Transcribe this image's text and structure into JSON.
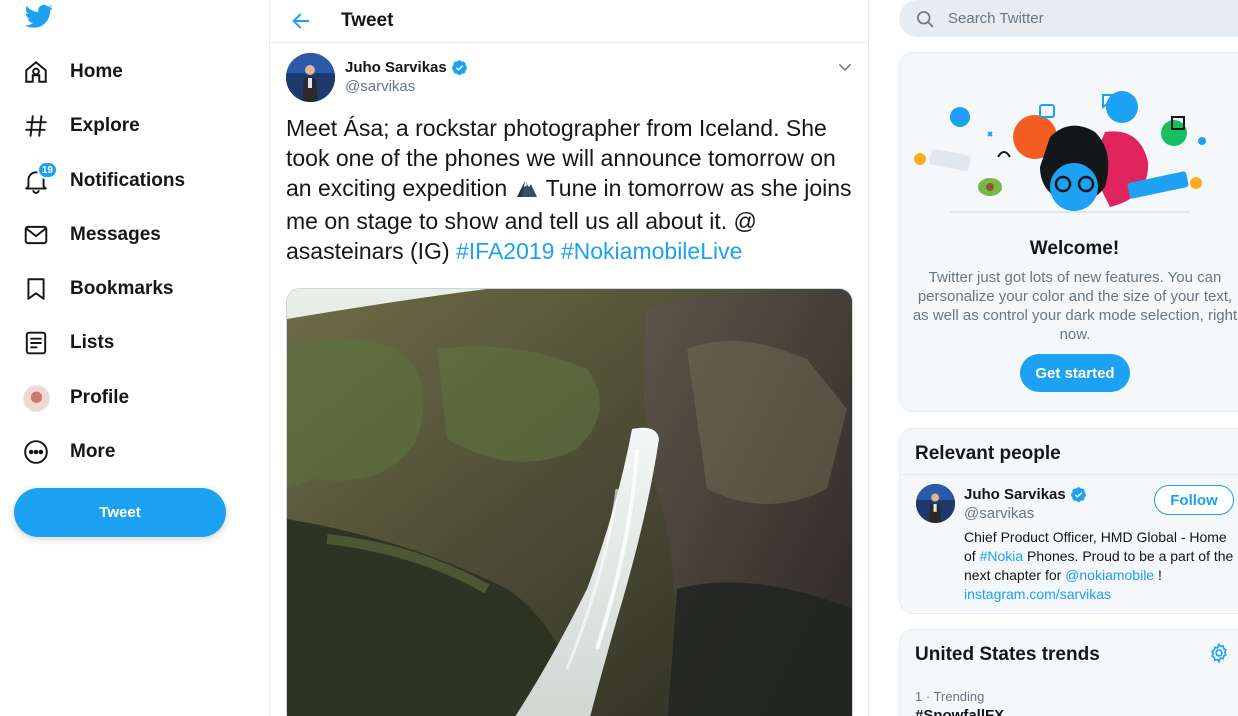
{
  "nav": {
    "logo_icon": "twitter-bird-icon",
    "items": [
      {
        "label": "Home",
        "icon": "home-icon"
      },
      {
        "label": "Explore",
        "icon": "hashtag-icon"
      },
      {
        "label": "Notifications",
        "icon": "bell-icon",
        "badge": "19"
      },
      {
        "label": "Messages",
        "icon": "envelope-icon"
      },
      {
        "label": "Bookmarks",
        "icon": "bookmark-icon"
      },
      {
        "label": "Lists",
        "icon": "list-icon"
      },
      {
        "label": "Profile",
        "icon": "avatar"
      },
      {
        "label": "More",
        "icon": "more-icon"
      }
    ],
    "tweet_button": "Tweet"
  },
  "header": {
    "title": "Tweet"
  },
  "tweet": {
    "author_name": "Juho Sarvikas",
    "author_handle": "@sarvikas",
    "text_1": "Meet Ása; a rockstar photographer from Iceland. She took one of the phones we will announce tomorrow on an exciting expedition ",
    "text_2": " Tune in tomorrow as she joins me on stage to show and tell us all about it. @ asasteinars (IG) ",
    "hashtag_1": "#IFA2019",
    "hashtag_2": "#NokiamobileLive"
  },
  "search": {
    "placeholder": "Search Twitter"
  },
  "welcome": {
    "title": "Welcome!",
    "body": "Twitter just got lots of new features. You can personalize your color and the size of your text, as well as control your dark mode selection, right now.",
    "button": "Get started"
  },
  "relevant": {
    "title": "Relevant people",
    "name": "Juho Sarvikas",
    "handle": "@sarvikas",
    "follow": "Follow",
    "bio_1": "Chief Product Officer, HMD Global - Home of ",
    "bio_link_1": "#Nokia",
    "bio_2": " Phones. Proud to be a part of the next chapter for ",
    "bio_link_2": "@nokiamobile",
    "bio_3": " ! ",
    "bio_link_3": "instagram.com/sarvikas"
  },
  "trends": {
    "title": "United States trends",
    "items": [
      {
        "meta": "1 · Trending",
        "name": "#SnowfallFX"
      }
    ]
  },
  "colors": {
    "accent": "#1da1f2",
    "text": "#14171a",
    "muted": "#657786",
    "border": "#e6ecf0"
  }
}
